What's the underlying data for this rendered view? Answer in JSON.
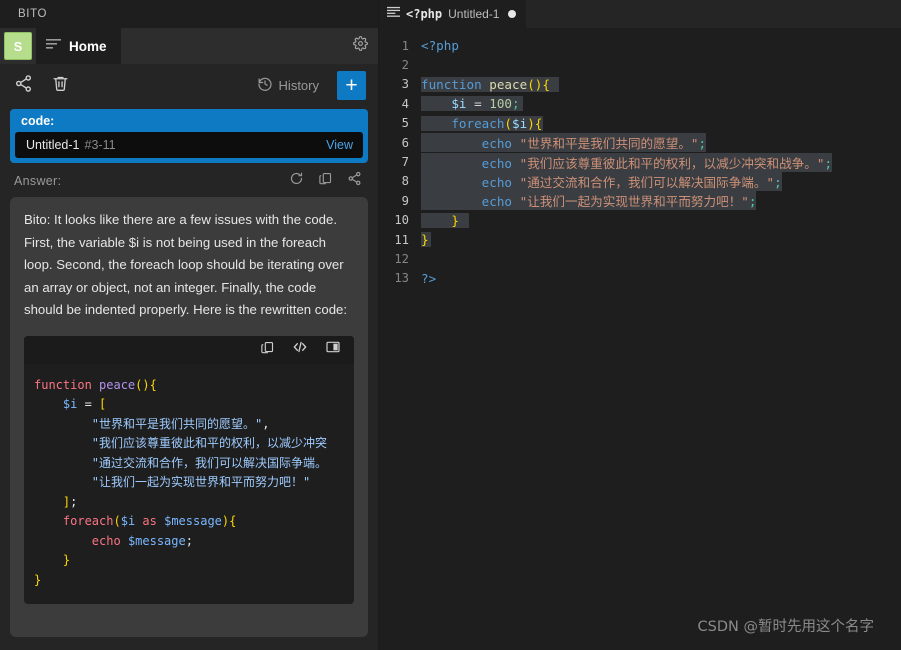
{
  "extension": {
    "title": "BITO",
    "avatar_initial": "S",
    "tab_label": "Home",
    "icons": {
      "lines": "lines-icon",
      "gear": "gear-icon",
      "share": "share-icon",
      "trash": "trash-icon",
      "history": "history-icon",
      "plus": "plus-icon"
    },
    "toolbar": {
      "history_label": "History",
      "plus_label": "+"
    },
    "code_ref": {
      "label": "code:",
      "file": "Untitled-1",
      "lines": "#3-11",
      "view_label": "View"
    },
    "answer": {
      "label": "Answer:",
      "text": "Bito: It looks like there are a few issues with the code. First, the variable $i is not being used in the foreach loop. Second, the foreach loop should be iterating over an array or object, not an integer. Finally, the code should be indented properly. Here is the rewritten code:",
      "code_lines": [
        [
          [
            "l-kw",
            "function"
          ],
          [
            "l-pun",
            " "
          ],
          [
            "l-fn",
            "peace"
          ],
          [
            "l-yel",
            "()"
          ],
          [
            "l-yel",
            "{"
          ]
        ],
        [
          [
            "l-pun",
            "    "
          ],
          [
            "l-var",
            "$i"
          ],
          [
            "l-pun",
            " = "
          ],
          [
            "l-yel",
            "["
          ]
        ],
        [
          [
            "l-pun",
            "        "
          ],
          [
            "l-str",
            "\"世界和平是我们共同的愿望。\""
          ],
          [
            "l-pun",
            ","
          ]
        ],
        [
          [
            "l-pun",
            "        "
          ],
          [
            "l-str",
            "\"我们应该尊重彼此和平的权利，以减少冲突"
          ]
        ],
        [
          [
            "l-pun",
            "        "
          ],
          [
            "l-str",
            "\"通过交流和合作，我们可以解决国际争端。"
          ]
        ],
        [
          [
            "l-pun",
            "        "
          ],
          [
            "l-str",
            "\"让我们一起为实现世界和平而努力吧！\""
          ]
        ],
        [
          [
            "l-pun",
            "    "
          ],
          [
            "l-yel",
            "]"
          ],
          [
            "l-pun",
            ";"
          ]
        ],
        [
          [
            "l-pun",
            "    "
          ],
          [
            "l-kw",
            "foreach"
          ],
          [
            "l-yel",
            "("
          ],
          [
            "l-var",
            "$i"
          ],
          [
            "l-pun",
            " "
          ],
          [
            "l-kw",
            "as"
          ],
          [
            "l-pun",
            " "
          ],
          [
            "l-var",
            "$message"
          ],
          [
            "l-yel",
            ")"
          ],
          [
            "l-yel",
            "{"
          ]
        ],
        [
          [
            "l-pun",
            "        "
          ],
          [
            "l-kw",
            "echo"
          ],
          [
            "l-pun",
            " "
          ],
          [
            "l-var",
            "$message"
          ],
          [
            "l-pun",
            ";"
          ]
        ],
        [
          [
            "l-pun",
            "    "
          ],
          [
            "l-yel",
            "}"
          ]
        ],
        [
          [
            "l-yel",
            "}"
          ]
        ]
      ]
    }
  },
  "editor": {
    "tab": {
      "lang": "<?php",
      "filename": "Untitled-1",
      "dirty": true
    },
    "selection": {
      "from": 3,
      "to": 11
    },
    "lines": [
      {
        "n": 1,
        "tokens": [
          [
            "r-tag",
            "<?php"
          ]
        ]
      },
      {
        "n": 2,
        "tokens": []
      },
      {
        "n": 3,
        "tokens": [
          [
            "r-kw",
            "function"
          ],
          [
            "r-pun",
            " "
          ],
          [
            "r-fn",
            "peace"
          ],
          [
            "r-b1",
            "()"
          ],
          [
            "r-b1",
            "{"
          ]
        ],
        "sel": true,
        "selw": 138
      },
      {
        "n": 4,
        "tokens": [
          [
            "indent-guide",
            "····"
          ],
          [
            "r-var",
            "$i"
          ],
          [
            "r-pun",
            " = "
          ],
          [
            "r-num",
            "100"
          ],
          [
            "r-semi",
            ";"
          ]
        ],
        "sel": true,
        "selw": 102
      },
      {
        "n": 5,
        "tokens": [
          [
            "indent-guide",
            "····"
          ],
          [
            "r-kw",
            "foreach"
          ],
          [
            "r-b1",
            "("
          ],
          [
            "r-var",
            "$i"
          ],
          [
            "r-b1",
            ")"
          ],
          [
            "r-b1",
            "{"
          ]
        ],
        "sel": true,
        "selw": 122
      },
      {
        "n": 6,
        "tokens": [
          [
            "indent-guide",
            "········"
          ],
          [
            "r-kw",
            "echo"
          ],
          [
            "r-pun",
            " "
          ],
          [
            "r-str",
            "\"世界和平是我们共同的愿望。\""
          ],
          [
            "r-semi",
            ";"
          ]
        ],
        "sel": true,
        "selw": 238
      },
      {
        "n": 7,
        "tokens": [
          [
            "indent-guide",
            "········"
          ],
          [
            "r-kw",
            "echo"
          ],
          [
            "r-pun",
            " "
          ],
          [
            "r-str",
            "\"我们应该尊重彼此和平的权利，以减少冲突和战争。\""
          ],
          [
            "r-semi",
            ";"
          ]
        ],
        "sel": true,
        "selw": 388
      },
      {
        "n": 8,
        "tokens": [
          [
            "indent-guide",
            "········"
          ],
          [
            "r-kw",
            "echo"
          ],
          [
            "r-pun",
            " "
          ],
          [
            "r-str",
            "\"通过交流和合作，我们可以解决国际争端。\""
          ],
          [
            "r-semi",
            ";"
          ]
        ],
        "sel": true,
        "selw": 325
      },
      {
        "n": 9,
        "tokens": [
          [
            "indent-guide",
            "········"
          ],
          [
            "r-kw",
            "echo"
          ],
          [
            "r-pun",
            " "
          ],
          [
            "r-str",
            "\"让我们一起为实现世界和平而努力吧！\""
          ],
          [
            "r-semi",
            ";"
          ]
        ],
        "sel": true,
        "selw": 300
      },
      {
        "n": 10,
        "tokens": [
          [
            "indent-guide",
            "····"
          ],
          [
            "r-b1",
            "}"
          ]
        ],
        "sel": true,
        "selw": 48
      },
      {
        "n": 11,
        "tokens": [
          [
            "r-b1",
            "}"
          ]
        ],
        "sel": true,
        "selw": 10
      },
      {
        "n": 12,
        "tokens": []
      },
      {
        "n": 13,
        "tokens": [
          [
            "r-tag",
            "?>"
          ]
        ]
      }
    ]
  },
  "watermark": "CSDN @暂时先用这个名字",
  "colors": {
    "accent_blue": "#0e7ac4",
    "panel_bg": "#252526",
    "editor_bg": "#1e1e1e",
    "answer_card_bg": "#3c3c3c",
    "avatar_green": "#b5dd8c",
    "selection": "#3a3d41"
  }
}
